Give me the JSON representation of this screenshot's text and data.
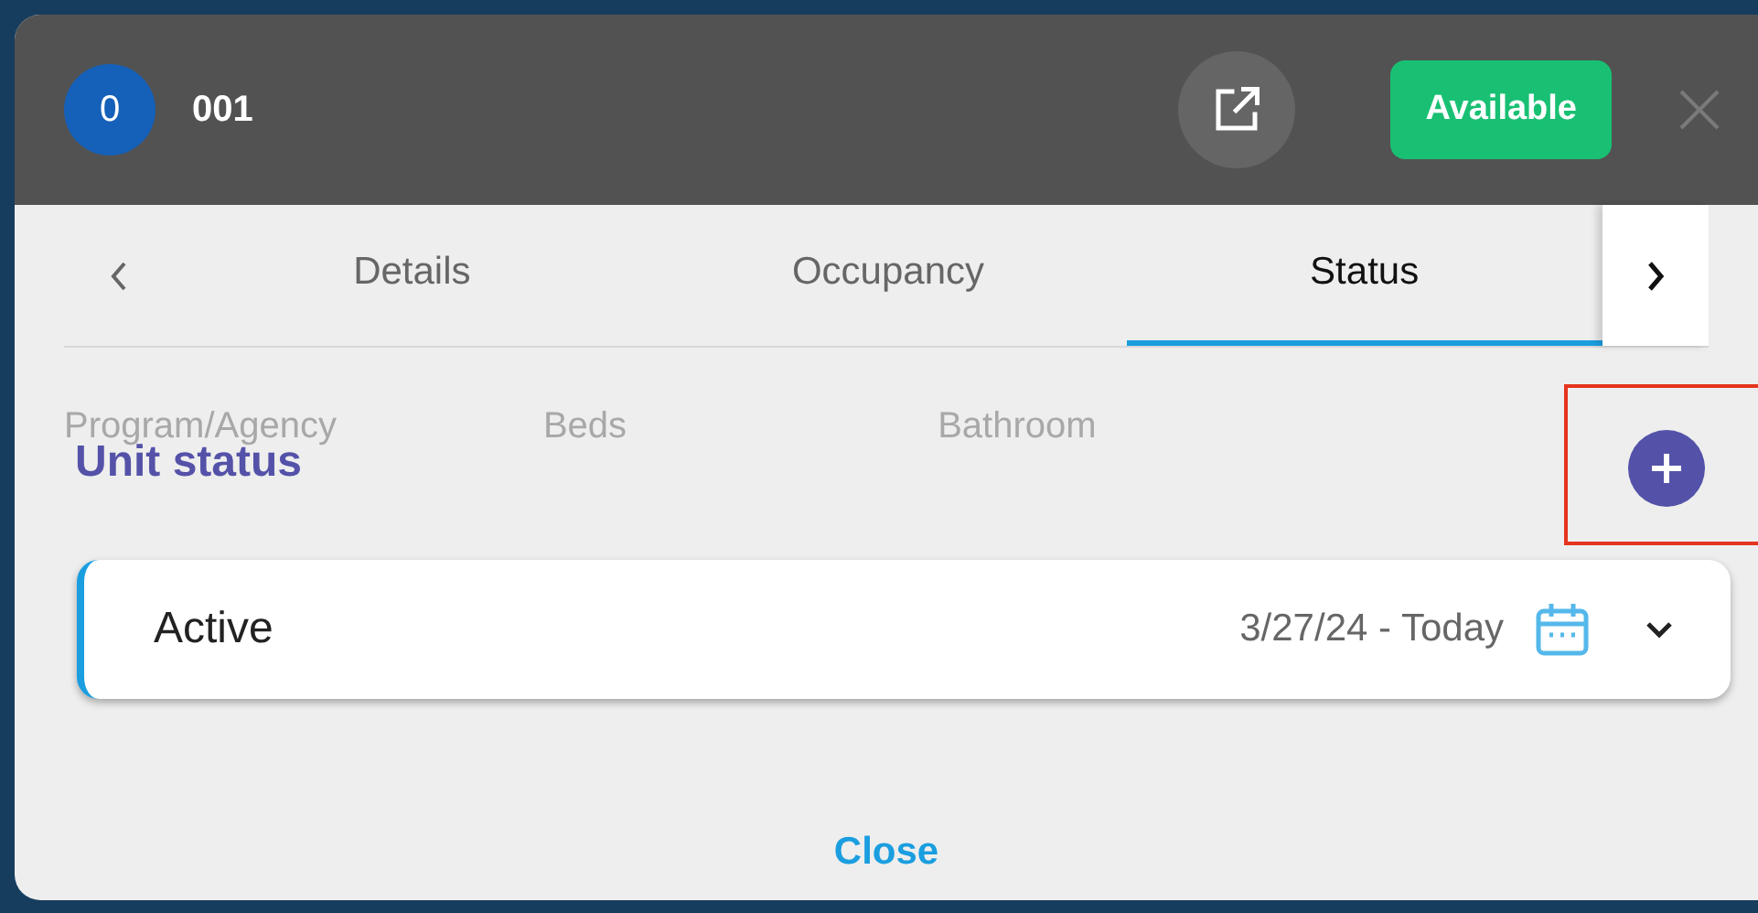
{
  "header": {
    "avatar": "0",
    "title": "001",
    "status_badge": "Available"
  },
  "tabs": [
    {
      "label": "Details",
      "selected": false
    },
    {
      "label": "Occupancy",
      "selected": false
    },
    {
      "label": "Status",
      "selected": true
    }
  ],
  "background_labels": [
    "Program/Agency",
    "Beds",
    "Bathroom"
  ],
  "section": {
    "title": "Unit status"
  },
  "statuses": [
    {
      "name": "Active",
      "dates": "3/27/24 - Today",
      "expanded": false
    }
  ],
  "close_button": "Close"
}
